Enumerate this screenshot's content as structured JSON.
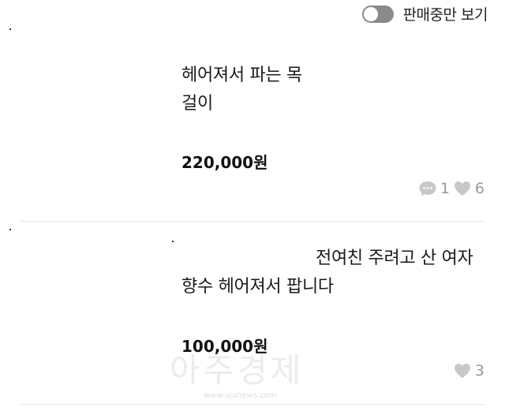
{
  "filter": {
    "label": "판매중만 보기",
    "enabled": false
  },
  "listings": [
    {
      "title": "헤어져서 파는 목걸이",
      "price": "220,000원",
      "comments": "1",
      "likes": "6"
    },
    {
      "title": "전여친 주려고 산 여자향수 헤어져서 팝니다",
      "price": "100,000원",
      "likes": "3"
    }
  ],
  "watermark": {
    "text": "아주경제",
    "url": "www.ajunews.com"
  },
  "colors": {
    "toggle_off": "#8a8a8a",
    "icon_gray": "#c8c8c8",
    "stat_text": "#999999"
  }
}
